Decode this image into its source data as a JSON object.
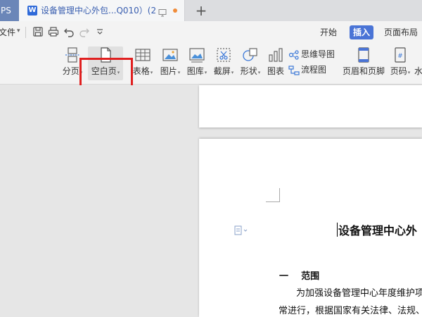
{
  "tabbar": {
    "app_tab_label": "PS",
    "document_tab_icon": "W",
    "document_tab_title": "设备管理中心外包...Q010）(2)",
    "add_tab_label": "+"
  },
  "quick_access": {
    "file_label": "文件",
    "caret": "▾"
  },
  "ribbon_tabs": [
    {
      "label": "开始"
    },
    {
      "label": "插入"
    },
    {
      "label": "页面布局"
    }
  ],
  "tools": {
    "page_break": "分页",
    "blank_page": "空白页",
    "table": "表格",
    "picture": "图片",
    "gallery": "图库",
    "screenshot": "截屏",
    "shapes": "形状",
    "chart": "图表",
    "mind_map": "思维导图",
    "flowchart": "流程图",
    "header_footer": "页眉和页脚",
    "page_number": "页码",
    "watermark": "水"
  },
  "document": {
    "heading": "设备管理中心外",
    "section_number": "一",
    "section_title": "范围",
    "body_line_1": "为加强设备管理中心年度维护项",
    "body_line_2": "常进行，根据国家有关法律、法规、"
  },
  "colors": {
    "accent": "#4a74d6",
    "highlight_box": "#e02020",
    "app_tab": "#6b86b8"
  }
}
